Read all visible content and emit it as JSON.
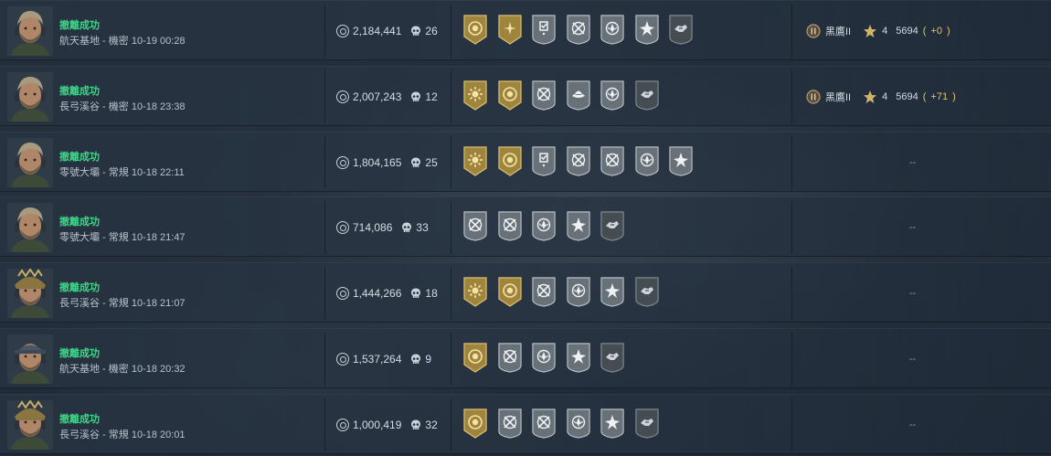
{
  "colors": {
    "status_green": "#3fd68a",
    "gold_badge": "#c6a451",
    "silver_badge": "#a5adb5",
    "dark_badge": "#5f666d",
    "delta_gold": "#e3c46e"
  },
  "rows": [
    {
      "status": "撤離成功",
      "meta": "航天基地 - 機密 10-19 00:28",
      "value": "2,184,441",
      "kills": "26",
      "avatar": "operator-bearded-headset",
      "badges": [
        "gold-emblem-icon",
        "gold-wings-icon",
        "silver-checklist-icon",
        "silver-crossed-guns-icon",
        "silver-crest-icon",
        "silver-star-burst-icon",
        "dark-handshake-icon"
      ],
      "rank": {
        "name": "黑鷹II",
        "stars": "4",
        "score": "5694",
        "delta": "+0"
      }
    },
    {
      "status": "撤離成功",
      "meta": "長弓溪谷 - 機密 10-18 23:38",
      "value": "2,007,243",
      "kills": "12",
      "avatar": "operator-bearded-headset",
      "badges": [
        "gold-sunburst-icon",
        "gold-emblem-icon",
        "silver-crossed-guns-icon",
        "silver-hat-icon",
        "silver-crest-icon",
        "dark-handshake-icon"
      ],
      "rank": {
        "name": "黑鷹II",
        "stars": "4",
        "score": "5694",
        "delta": "+71"
      }
    },
    {
      "status": "撤離成功",
      "meta": "零號大壩 - 常規 10-18 22:11",
      "value": "1,804,165",
      "kills": "25",
      "avatar": "operator-bearded-headset",
      "badges": [
        "gold-sunburst-icon",
        "gold-emblem-icon",
        "silver-checklist-icon",
        "silver-crossed-guns-icon",
        "silver-crossed-guns-icon",
        "silver-crest-icon",
        "silver-star-burst-icon"
      ],
      "rank": null,
      "empty": "--"
    },
    {
      "status": "撤離成功",
      "meta": "零號大壩 - 常規 10-18 21:47",
      "value": "714,086",
      "kills": "33",
      "avatar": "operator-bearded-headset",
      "badges": [
        "silver-crossed-guns-icon",
        "silver-crossed-guns-icon",
        "silver-crest-icon",
        "silver-star-burst-icon",
        "dark-handshake-icon"
      ],
      "rank": null,
      "empty": "--"
    },
    {
      "status": "撤離成功",
      "meta": "長弓溪谷 - 常規 10-18 21:07",
      "value": "1,444,266",
      "kills": "18",
      "avatar": "operator-gold-helmet",
      "badges": [
        "gold-sunburst-icon",
        "gold-emblem-icon",
        "silver-crossed-guns-icon",
        "silver-crest-icon",
        "silver-star-burst-icon",
        "dark-handshake-icon"
      ],
      "rank": null,
      "empty": "--"
    },
    {
      "status": "撤離成功",
      "meta": "航天基地 - 機密 10-18 20:32",
      "value": "1,537,264",
      "kills": "9",
      "avatar": "operator-cap-headset",
      "badges": [
        "gold-emblem-icon",
        "silver-crossed-guns-icon",
        "silver-crest-icon",
        "silver-star-burst-icon",
        "dark-handshake-icon"
      ],
      "rank": null,
      "empty": "--"
    },
    {
      "status": "撤離成功",
      "meta": "長弓溪谷 - 常規 10-18 20:01",
      "value": "1,000,419",
      "kills": "32",
      "avatar": "operator-gold-helmet",
      "badges": [
        "gold-emblem-icon",
        "silver-crossed-guns-icon",
        "silver-crossed-guns-icon",
        "silver-crest-icon",
        "silver-star-burst-icon",
        "dark-handshake-icon"
      ],
      "rank": null,
      "empty": "--"
    }
  ]
}
